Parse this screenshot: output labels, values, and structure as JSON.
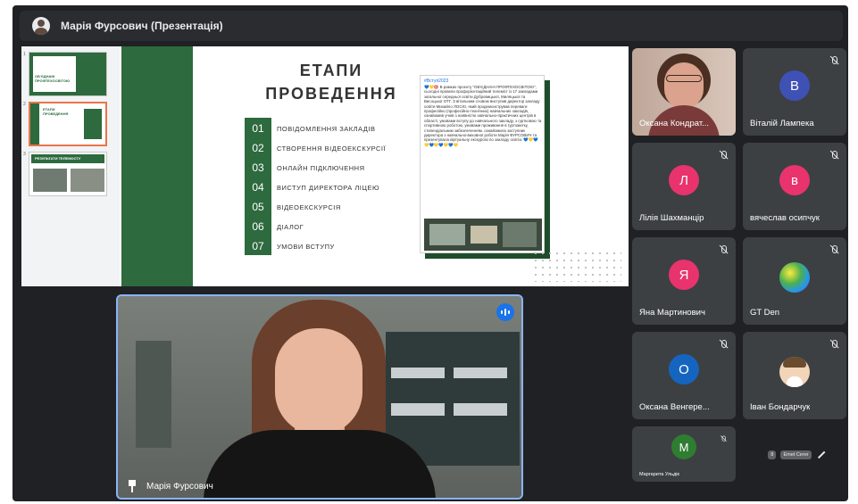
{
  "header": {
    "title": "Марія Фурсович (Презентація)"
  },
  "slide": {
    "title_line1": "ЕТАПИ",
    "title_line2": "ПРОВЕДЕННЯ",
    "stages": [
      {
        "num": "01",
        "label": "ПОВІДОМЛЕННЯ ЗАКЛАДІВ"
      },
      {
        "num": "02",
        "label": "СТВОРЕННЯ ВІДЕОЕКСКУРСІЇ"
      },
      {
        "num": "03",
        "label": "ОНЛАЙН ПІДКЛЮЧЕННЯ"
      },
      {
        "num": "04",
        "label": "ВИСТУП ДИРЕКТОРА ЛІЦЕЮ"
      },
      {
        "num": "05",
        "label": "ВІДЕОЕКСКУРСІЯ"
      },
      {
        "num": "06",
        "label": "ДІАЛОГ"
      },
      {
        "num": "07",
        "label": "УМОВИ ВСТУПУ"
      }
    ],
    "post_tag": "#Вступ2023",
    "post_text": "💙💛🎯 В рамках проєкту \"ОБ'ЄДНАНІ ПРОФТЕХОСВІТОЮ\", сьогодні провели профорієнтаційний телеміст із 17 закладами загальної середньої освіти Дубровицької, Миляцької та Висоцької ОТГ. З вітальним словом виступив директор закладу освіти Михайло ЛОСЮ, який продемонстрував переваги професійно (професійно-технічних) навчальних закладів, ознайомив учнів з наявністю навчально-практичних центрів в області, умовами вступу до навчального закладу, з гуртковою та спортивною роботою, умовами проживання в гуртожитку, стипендіальним забезпеченням. ознайомила заступник директора з навчально-виховної роботи Марія ФУРСОВИЧ та презентувала віртуальну екскурсію по закладу освіти. 💙💛💙💛💙💛💙💛💙💛"
  },
  "thumbnails": {
    "t1_text": "ОБ'ЄДНАНІ ПРОФТЕХОСВІТОЮ",
    "t2_text": "ЕТАПИ ПРОВЕДЕННЯ",
    "t3_text": "РЕЗУЛЬТАТИ ТЕЛЕМОСТУ"
  },
  "speaker": {
    "name": "Марія Фурсович"
  },
  "participants": [
    {
      "name": "Оксана Кондрат...",
      "initial": "",
      "muted": false
    },
    {
      "name": "Віталій Лампека",
      "initial": "В",
      "color": "#3f51b5",
      "muted": true
    },
    {
      "name": "Лілія Шахманцір",
      "initial": "Л",
      "color": "#e8336d",
      "muted": true
    },
    {
      "name": "вячеслав осипчук",
      "initial": "в",
      "color": "#e8336d",
      "muted": true
    },
    {
      "name": "Яна Мартинович",
      "initial": "Я",
      "color": "#e8336d",
      "muted": true
    },
    {
      "name": "GT Den",
      "initial": "",
      "muted": true
    },
    {
      "name": "Оксана Венгере...",
      "initial": "О",
      "color": "#1565c0",
      "muted": true
    },
    {
      "name": "Іван Бондарчук",
      "initial": "",
      "muted": true
    },
    {
      "name": "Маргарита Ульдік",
      "initial": "М",
      "color": "#2e7d32",
      "muted": true
    }
  ],
  "extra": {
    "count_label": "8",
    "chip_label": "Emet Cerer"
  },
  "colors": {
    "meet_bg": "#202124",
    "tile_bg": "#3c4043",
    "slide_green": "#2d6a3e",
    "active_speaker_border": "#8ab4f8"
  }
}
